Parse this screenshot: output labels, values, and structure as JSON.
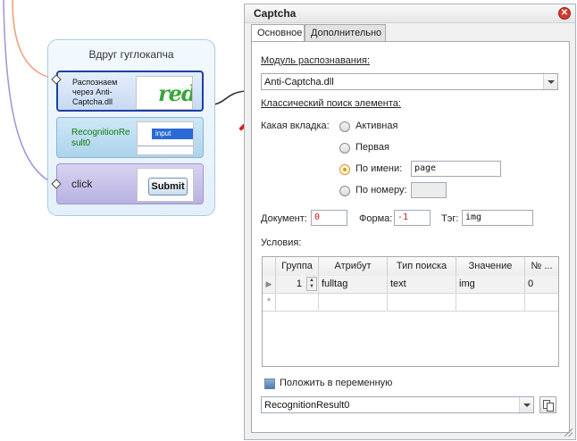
{
  "workflow": {
    "group_title": "Вдруг гуглокапча",
    "actions": [
      {
        "label": "Распознаем через Anti-Captcha.dll",
        "thumb_text": "red"
      },
      {
        "label": "RecognitionResult0",
        "thumb_text": "input"
      },
      {
        "label": "click",
        "thumb_text": "Submit"
      }
    ]
  },
  "dialog": {
    "title": "Captcha",
    "close_icon": "close-icon",
    "tabs": [
      {
        "label": "Основное",
        "active": true
      },
      {
        "label": "Дополнительно",
        "active": false
      }
    ],
    "module_label": "Модуль распознавания:",
    "module_value": "Anti-Captcha.dll",
    "classic_search_label": "Классический поиск элемента:",
    "which_tab_label": "Какая вкладка:",
    "radio_options": [
      {
        "label": "Активная",
        "selected": false
      },
      {
        "label": "Первая",
        "selected": false
      },
      {
        "label": "По имени:",
        "selected": true,
        "value": "page"
      },
      {
        "label": "По номеру:",
        "selected": false,
        "value": ""
      }
    ],
    "document_label": "Документ:",
    "document_value": "0",
    "form_label": "Форма:",
    "form_value": "-1",
    "tag_label": "Тэг:",
    "tag_value": "img",
    "conditions_label": "Условия:",
    "grid": {
      "columns": [
        "Группа",
        "Атрибут",
        "Тип поиска",
        "Значение",
        "№ ..."
      ],
      "rows": [
        {
          "group": "1",
          "attribute": "fulltag",
          "search_type": "text",
          "value": "img",
          "number": "0"
        }
      ],
      "new_row_marker": "*"
    },
    "save_to_var_label": "Положить в переменную",
    "save_to_var_checked": true,
    "variable_value": "RecognitionResult0"
  },
  "colors": {
    "accent_selected": "#1f3fa6",
    "arrow_red": "#e01a1a",
    "radio_selected": "#e29a12",
    "close_red": "#d23b2f"
  }
}
